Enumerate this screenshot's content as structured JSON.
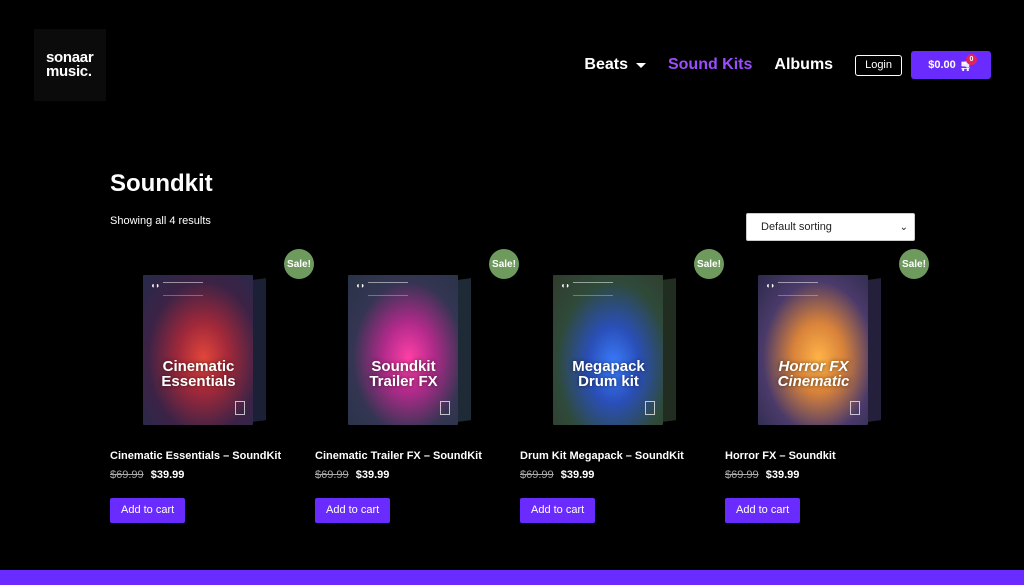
{
  "logo": {
    "line1": "sonaar",
    "line2": "music."
  },
  "nav": {
    "items": [
      {
        "label": "Beats",
        "has_dropdown": true,
        "active": false
      },
      {
        "label": "Sound Kits",
        "active": true
      },
      {
        "label": "Albums",
        "active": false
      }
    ],
    "login_label": "Login",
    "cart_total": "$0.00",
    "cart_count": "0"
  },
  "shop": {
    "title": "Soundkit",
    "result_count": "Showing all 4 results",
    "sorting_selected": "Default sorting"
  },
  "products": [
    {
      "name": "Cinematic Essentials – SoundKit",
      "old_price": "$69.99",
      "price": "$39.99",
      "badge": "Sale!",
      "cta": "Add to cart",
      "cover_text": "Cinematic Essentials"
    },
    {
      "name": "Cinematic Trailer FX – SoundKit",
      "old_price": "$69.99",
      "price": "$39.99",
      "badge": "Sale!",
      "cta": "Add to cart",
      "cover_text": "Soundkit Trailer FX"
    },
    {
      "name": "Drum Kit Megapack – SoundKit",
      "old_price": "$69.99",
      "price": "$39.99",
      "badge": "Sale!",
      "cta": "Add to cart",
      "cover_text": "Megapack Drum kit"
    },
    {
      "name": "Horror FX – Soundkit",
      "old_price": "$69.99",
      "price": "$39.99",
      "badge": "Sale!",
      "cta": "Add to cart",
      "cover_text": "Horror FX Cinematic"
    }
  ],
  "colors": {
    "accent": "#6a2bff",
    "nav_active": "#9b4dff",
    "sale_badge": "#6e9a5e",
    "background": "#000000"
  }
}
